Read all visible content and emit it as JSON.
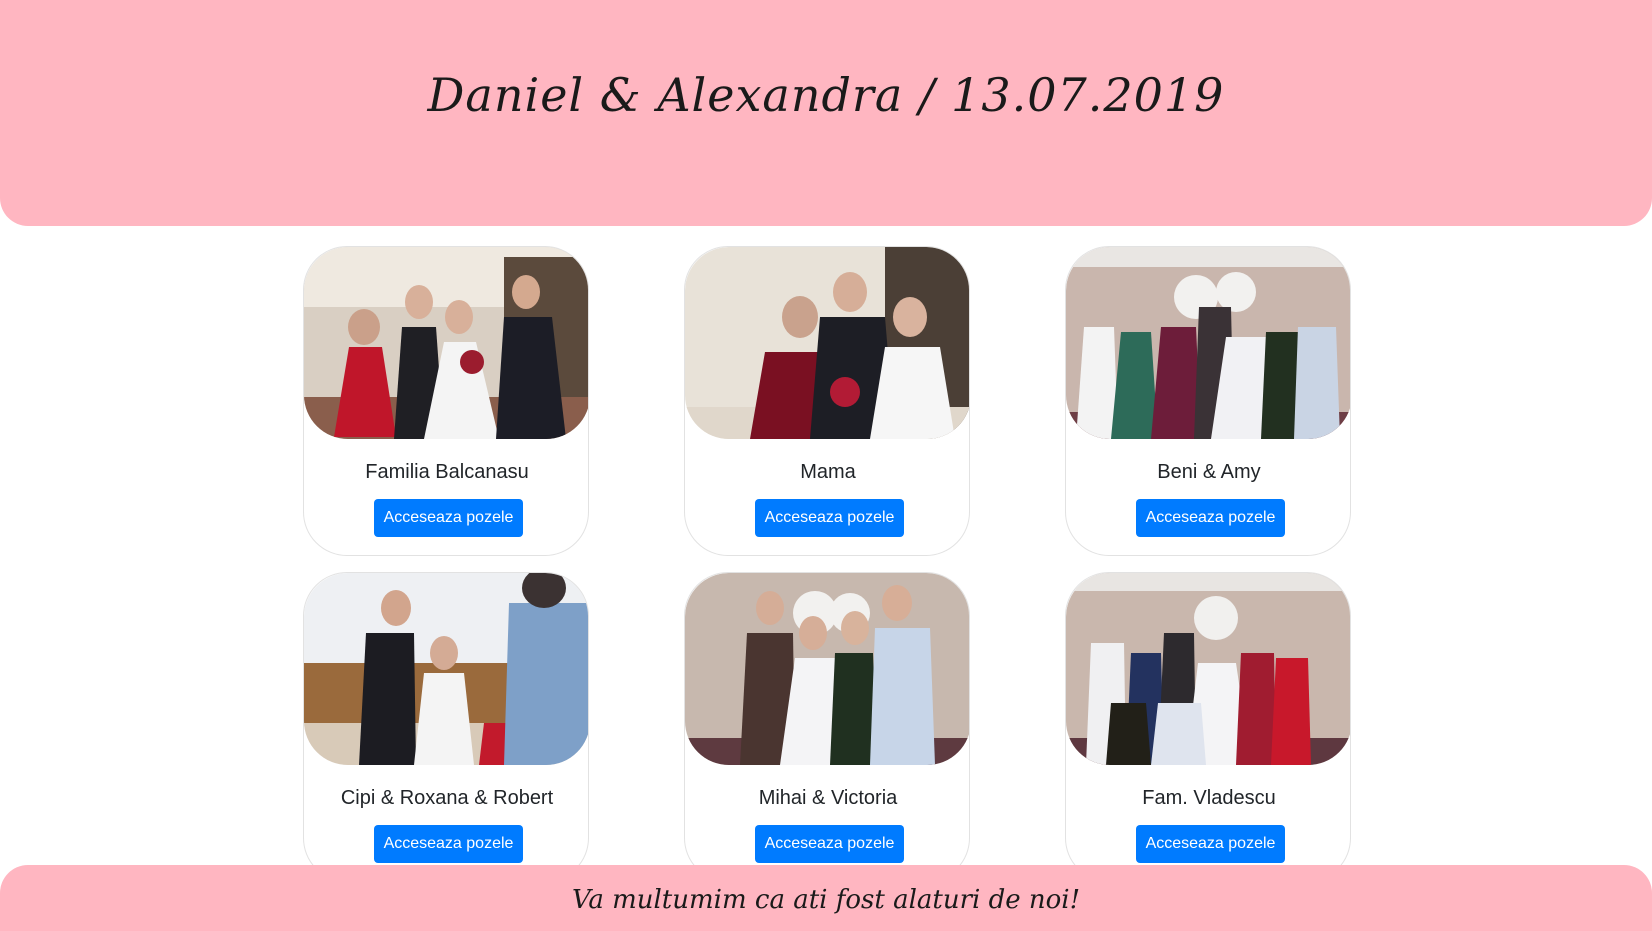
{
  "header": {
    "title": "Daniel & Alexandra / 13.07.2019"
  },
  "cards": [
    {
      "name": "Familia Balcanasu",
      "button_label": "Acceseaza pozele"
    },
    {
      "name": "Mama",
      "button_label": "Acceseaza pozele"
    },
    {
      "name": "Beni & Amy",
      "button_label": "Acceseaza pozele"
    },
    {
      "name": "Cipi & Roxana & Robert",
      "button_label": "Acceseaza pozele"
    },
    {
      "name": "Mihai & Victoria",
      "button_label": "Acceseaza pozele"
    },
    {
      "name": "Fam. Vladescu",
      "button_label": "Acceseaza pozele"
    }
  ],
  "footer": {
    "text": "Va multumim ca ati fost alaturi de noi!"
  },
  "colors": {
    "header_bg": "#ffb6c1",
    "button_bg": "#007bff",
    "button_text": "#ffffff"
  }
}
